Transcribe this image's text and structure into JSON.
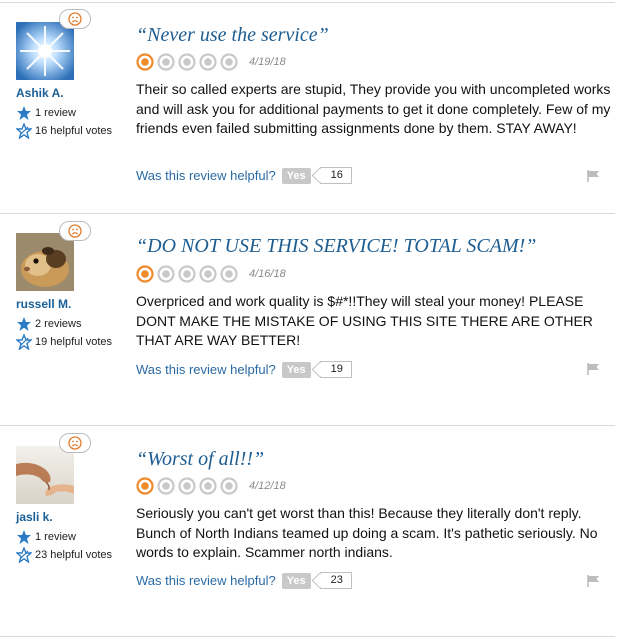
{
  "reviews": [
    {
      "user": "Ashik A.",
      "reviews_count": "1 review",
      "helpful_votes": "16 helpful votes",
      "title": "“Never use the service”",
      "rating": 1,
      "date": "4/19/18",
      "body": "Their so called experts are stupid, They provide you with uncompleted works and will ask you for additional payments to get it done completely. Few of my friends even failed submitting assignments done by them. STAY AWAY!",
      "helpful_q": "Was this review helpful?",
      "yes": "Yes",
      "votes": "16",
      "avatar": "sparkle-star-avatar"
    },
    {
      "user": "russell M.",
      "reviews_count": "2 reviews",
      "helpful_votes": "19 helpful votes",
      "title": "“DO NOT USE THIS SERVICE! TOTAL SCAM!”",
      "rating": 1,
      "date": "4/16/18",
      "body": "Overpriced and work quality is $#*!!They will steal your money! PLEASE DONT MAKE THE MISTAKE OF USING THIS SITE THERE ARE OTHER THAT ARE WAY BETTER!",
      "helpful_q": "Was this review helpful?",
      "yes": "Yes",
      "votes": "19",
      "avatar": "guinea-pig-avatar"
    },
    {
      "user": "jasli k.",
      "reviews_count": "1 review",
      "helpful_votes": "23 helpful votes",
      "title": "“Worst of all!!”",
      "rating": 1,
      "date": "4/12/18",
      "body": "Seriously you can't get worst than this! Because they literally don't reply. Bunch of North Indians teamed up doing a scam. It's pathetic seriously. No words to explain. Scammer north indians.",
      "helpful_q": "Was this review helpful?",
      "yes": "Yes",
      "votes": "23",
      "avatar": "hands-avatar"
    }
  ],
  "colors": {
    "link": "#1d5d91",
    "rating_fill": "#f0892b",
    "rating_empty": "#c9c9c9",
    "badge_blue": "#2d7bc4"
  },
  "icons": {
    "mood": "sad-face-icon",
    "reviews": "star-icon",
    "helpful": "star-outline-icon",
    "rating": "rating-bubble-icon",
    "flag": "flag-icon"
  }
}
